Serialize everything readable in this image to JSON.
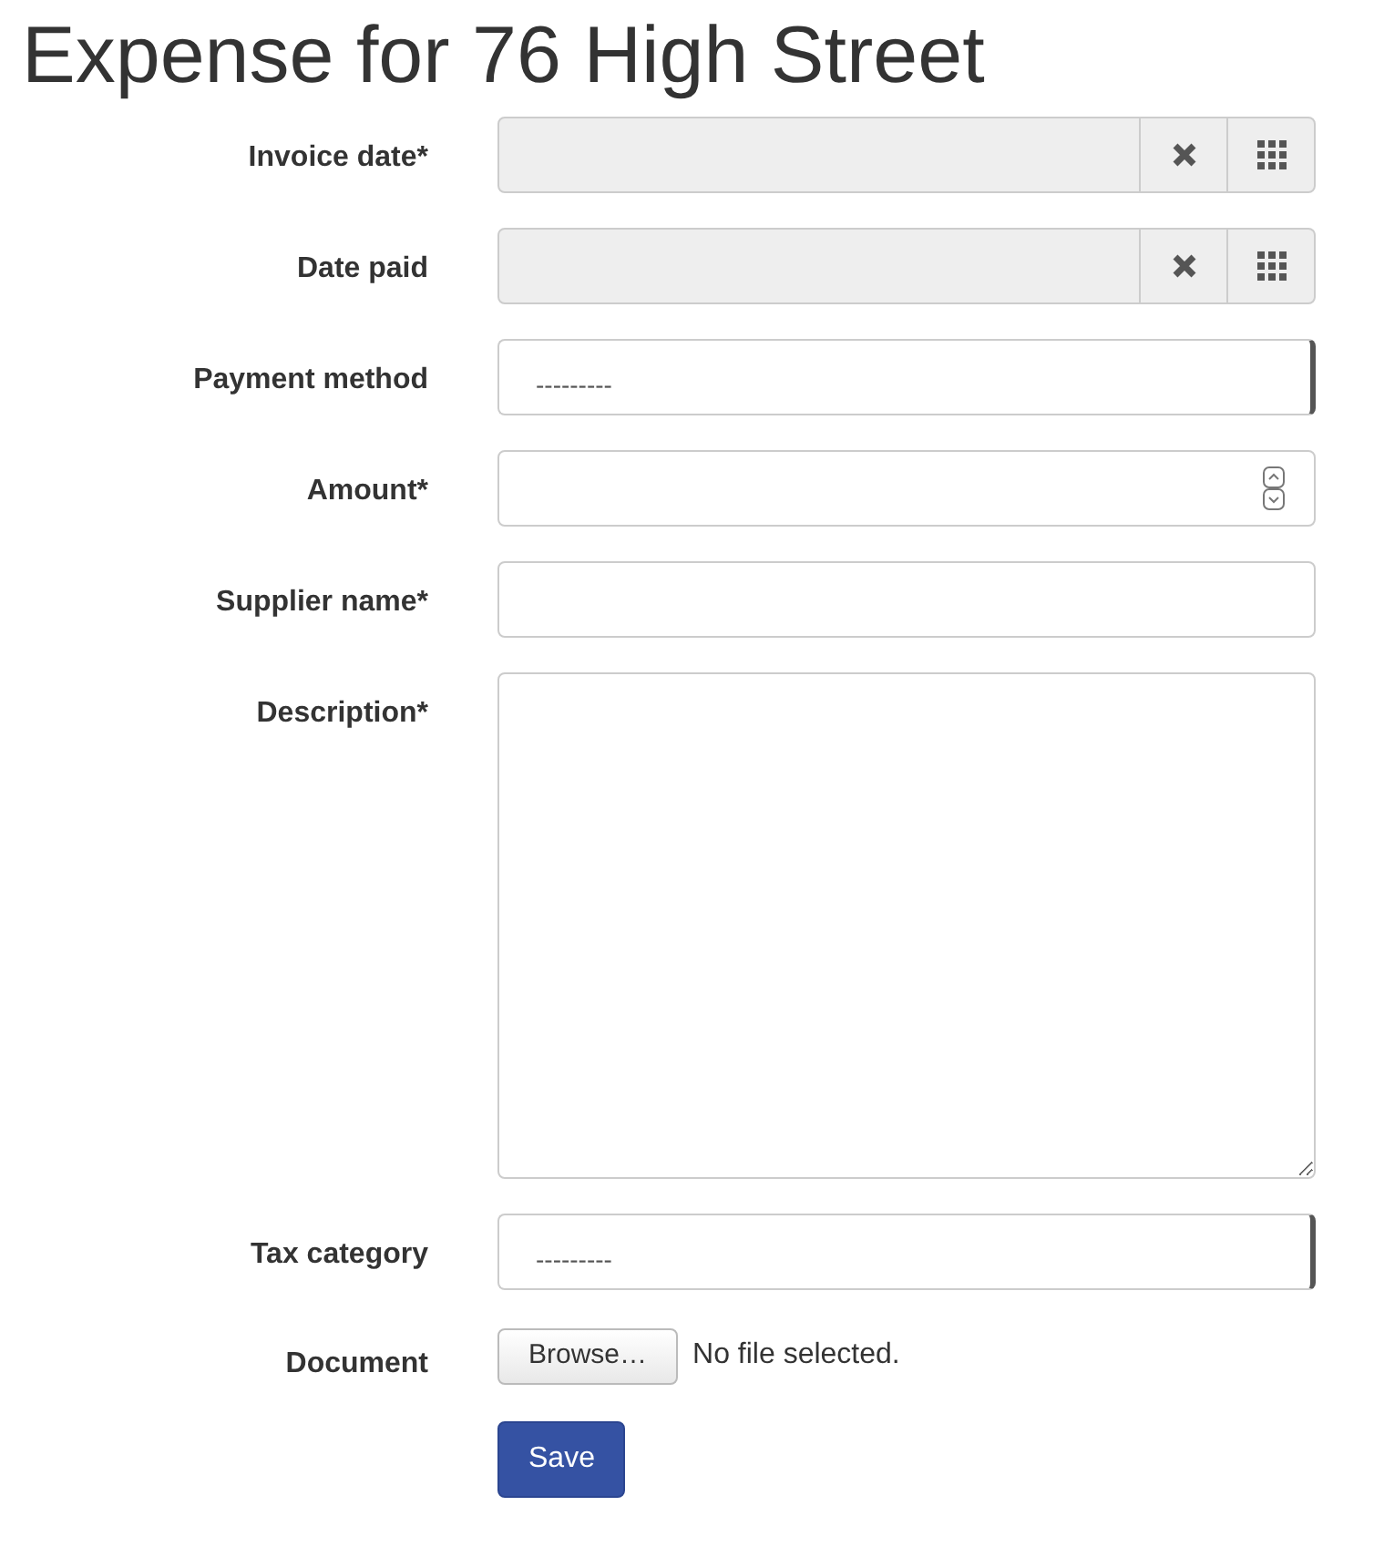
{
  "title": "Expense for 76 High Street",
  "fields": [
    {
      "kind": "date",
      "label": "Invoice date*"
    },
    {
      "kind": "date",
      "label": "Date paid"
    },
    {
      "kind": "select",
      "label": "Payment method",
      "value": "---------"
    },
    {
      "kind": "number",
      "label": "Amount*"
    },
    {
      "kind": "text",
      "label": "Supplier name*"
    },
    {
      "kind": "textarea",
      "label": "Description*"
    },
    {
      "kind": "select",
      "label": "Tax category",
      "value": "---------"
    },
    {
      "kind": "file",
      "label": "Document",
      "button": "Browse…",
      "status": "No file selected."
    }
  ],
  "submit": "Save"
}
